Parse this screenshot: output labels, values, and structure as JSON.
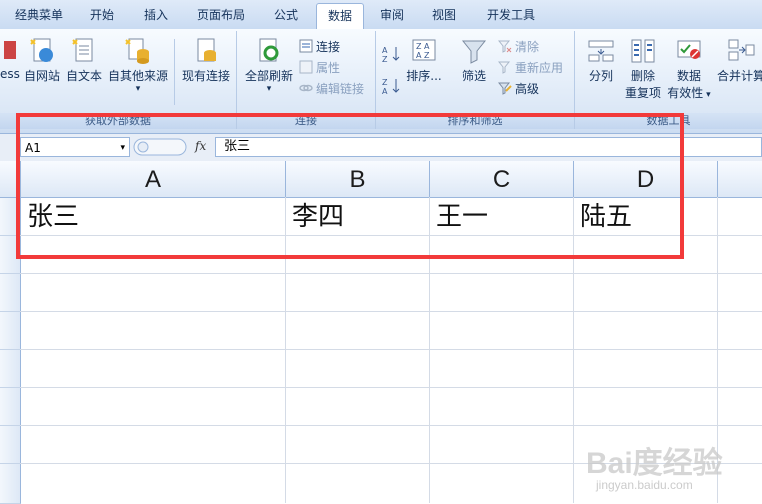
{
  "tabs": [
    "经典菜单",
    "开始",
    "插入",
    "页面布局",
    "公式",
    "数据",
    "审阅",
    "视图",
    "开发工具"
  ],
  "active_tab": "数据",
  "ribbon": {
    "get_external": {
      "label": "获取外部数据",
      "partial": "ess",
      "buttons": [
        "自网站",
        "自文本",
        "自其他来源",
        "现有连接"
      ]
    },
    "connections": {
      "label": "连接",
      "refresh_all": "全部刷新",
      "items": [
        "连接",
        "属性",
        "编辑链接"
      ]
    },
    "sort_filter": {
      "label": "排序和筛选",
      "sort": "排序...",
      "filter": "筛选",
      "items": [
        "清除",
        "重新应用",
        "高级"
      ]
    },
    "data_tools": {
      "label": "数据工具",
      "split": "分列",
      "remove_dup": [
        "删除",
        "重复项"
      ],
      "validation": [
        "数据",
        "有效性"
      ],
      "consolidate": "合并计算"
    }
  },
  "formula_bar": {
    "name_box": "A1",
    "fx": "fx",
    "value": "张三"
  },
  "columns": [
    "A",
    "B",
    "C",
    "D"
  ],
  "row1": [
    "张三",
    "李四",
    "王一",
    "陆五"
  ],
  "watermark": {
    "brand": "Bai度经验",
    "url": "jingyan.baidu.com"
  },
  "colors": {
    "highlight": "#f23a3a",
    "tab_bg": "#c9dbf2"
  }
}
